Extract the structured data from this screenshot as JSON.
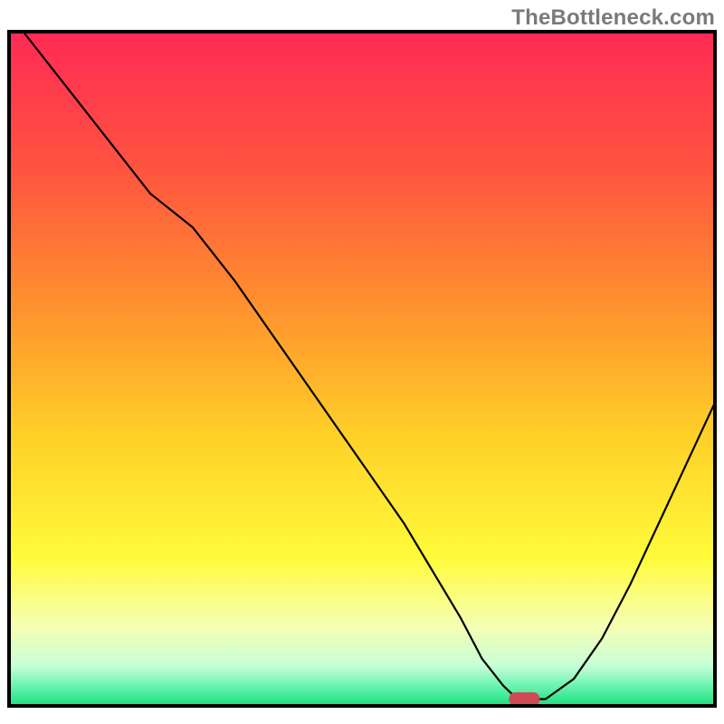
{
  "watermark": "TheBottleneck.com",
  "chart_data": {
    "type": "line",
    "title": "",
    "xlabel": "",
    "ylabel": "",
    "xlim": [
      0,
      100
    ],
    "ylim": [
      0,
      100
    ],
    "grid": false,
    "legend": false,
    "background_gradient": {
      "stops": [
        {
          "offset": 0.0,
          "color": "#ff2a55"
        },
        {
          "offset": 0.2,
          "color": "#ff5340"
        },
        {
          "offset": 0.4,
          "color": "#ff8f2f"
        },
        {
          "offset": 0.6,
          "color": "#ffd028"
        },
        {
          "offset": 0.78,
          "color": "#fffb3a"
        },
        {
          "offset": 0.88,
          "color": "#f6ffb1"
        },
        {
          "offset": 0.94,
          "color": "#c7ffd8"
        },
        {
          "offset": 0.97,
          "color": "#6cf3b0"
        },
        {
          "offset": 1.0,
          "color": "#19e07e"
        }
      ]
    },
    "series": [
      {
        "name": "bottleneck-curve",
        "x": [
          2,
          8,
          14,
          20,
          26,
          32,
          38,
          44,
          50,
          56,
          60,
          64,
          67,
          70,
          72,
          76,
          80,
          84,
          88,
          92,
          96,
          100
        ],
        "values": [
          100,
          92,
          84,
          76,
          71,
          63,
          54,
          45,
          36,
          27,
          20,
          13,
          7,
          3,
          1,
          1,
          4,
          10,
          18,
          27,
          36,
          45
        ]
      }
    ],
    "marker": {
      "name": "optimal-point",
      "x": 73,
      "y": 1,
      "color": "#cf4a55"
    }
  }
}
